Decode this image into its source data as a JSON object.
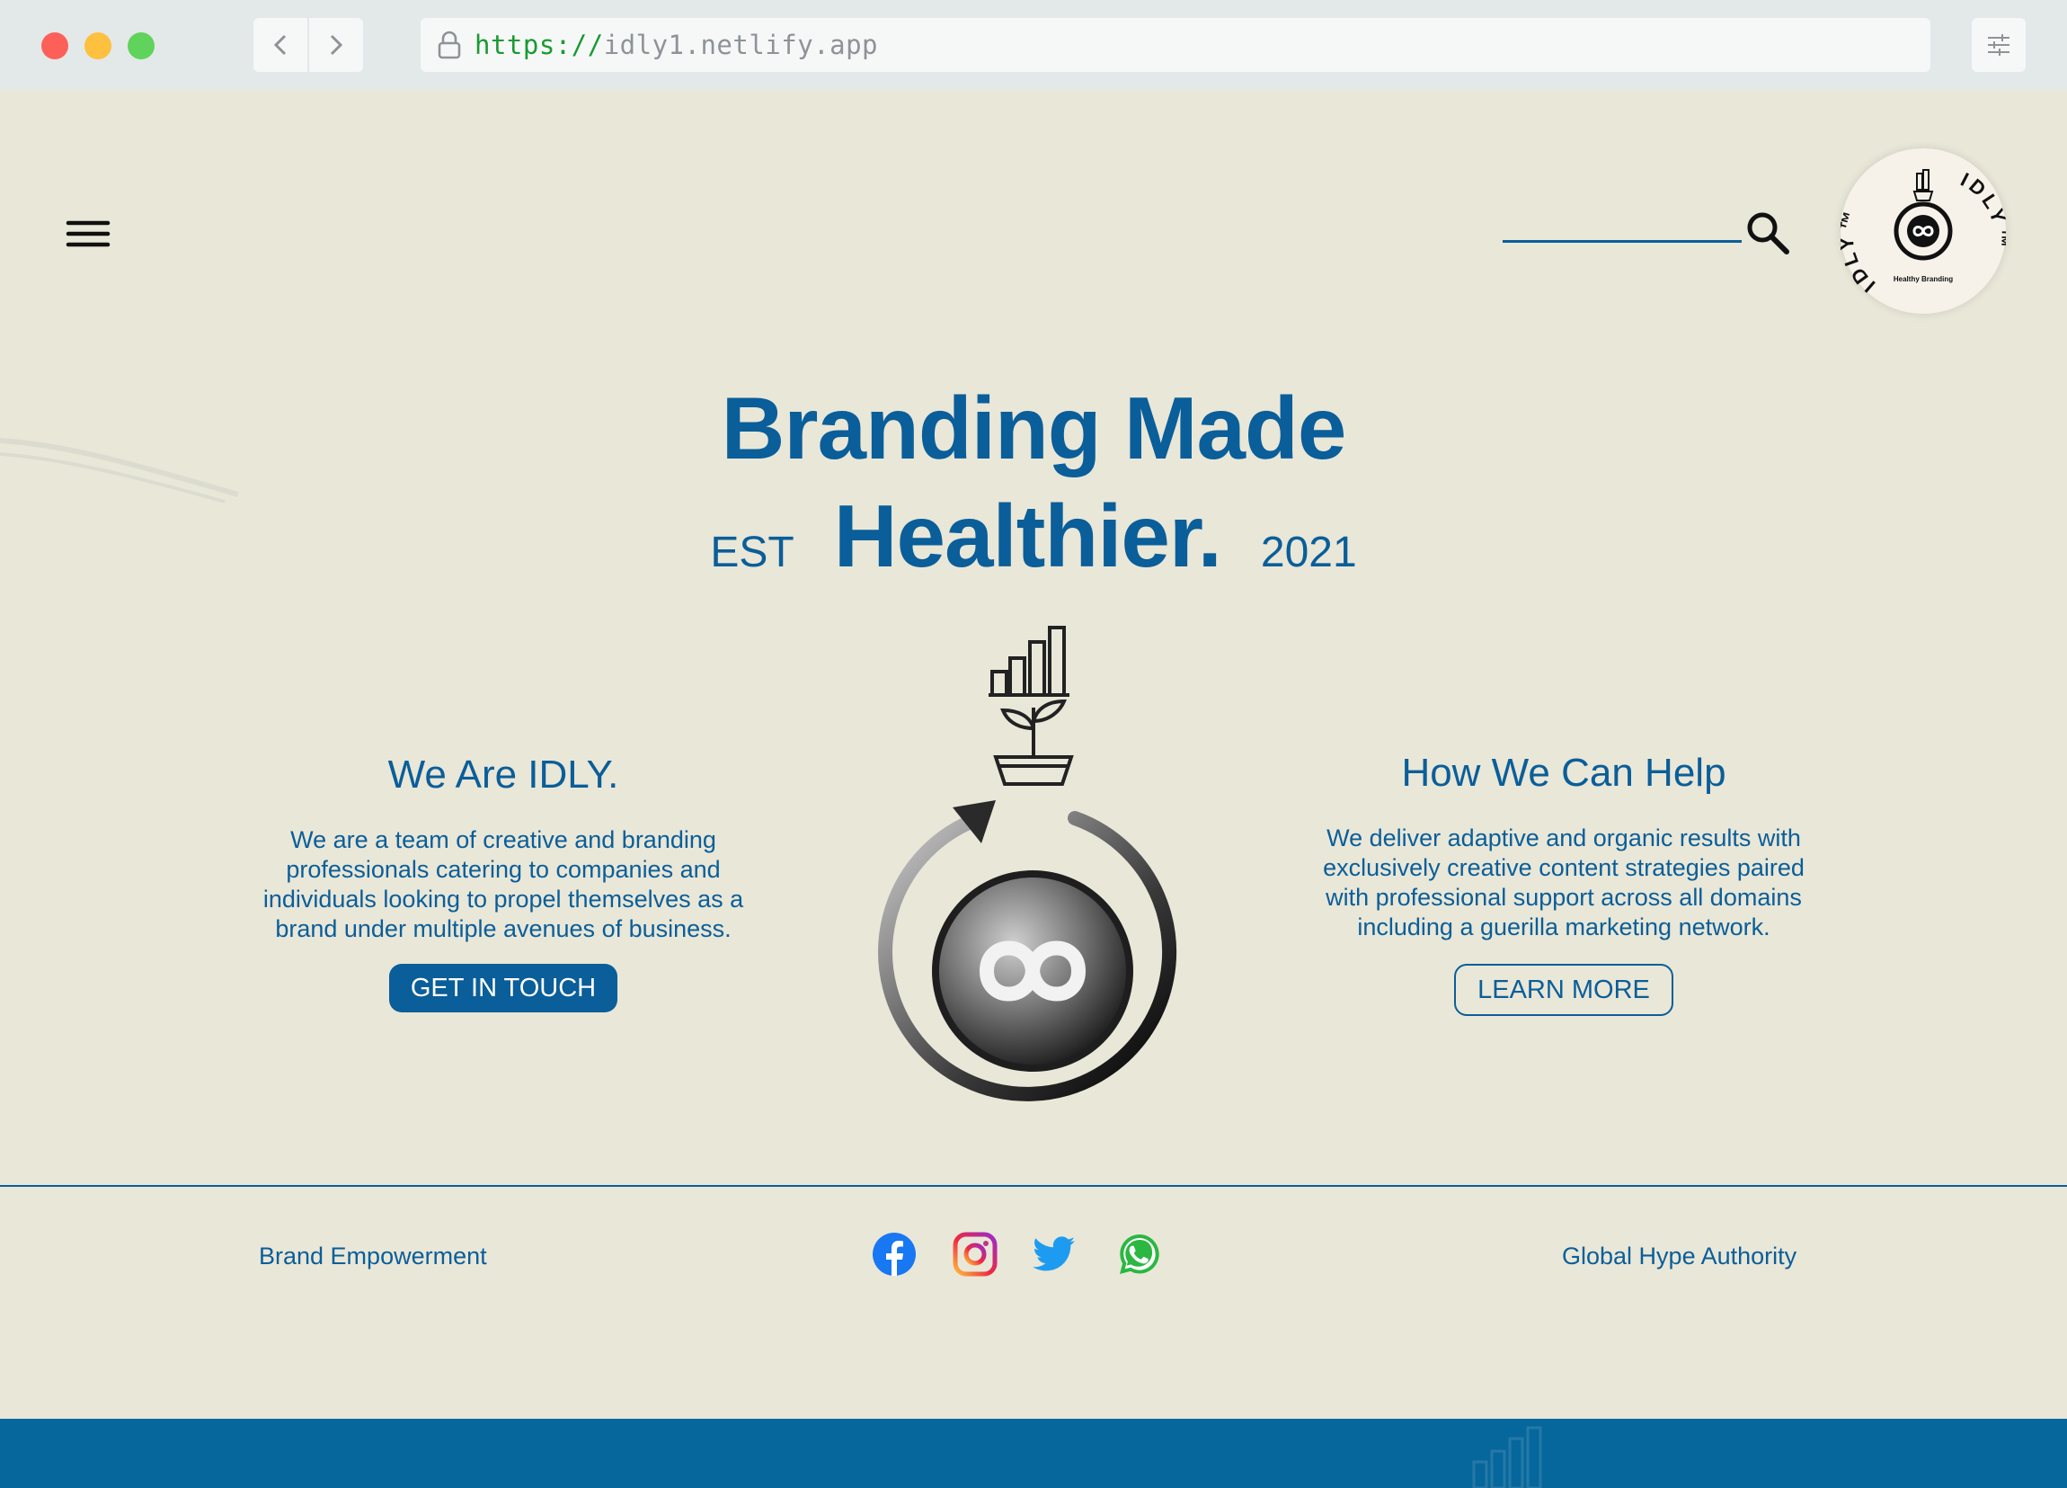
{
  "browser": {
    "url_scheme": "https://",
    "url_host": "idly1.netlify.app",
    "icons": [
      "back-icon",
      "forward-icon",
      "lock-icon",
      "sliders-icon"
    ]
  },
  "header": {
    "menu_icon": "hamburger-menu-icon",
    "search": {
      "value": "",
      "placeholder": ""
    },
    "search_icon": "search-icon",
    "logo": {
      "ring_text": "IDLY™ IDLY™",
      "tagline": "Healthy Branding"
    }
  },
  "hero": {
    "line1": "Branding Made",
    "line2_prefix": "EST",
    "line2_main": "Healthier.",
    "line2_suffix": "2021"
  },
  "about": {
    "heading": "We Are IDLY.",
    "body": "We are a team of creative and branding professionals catering to companies and individuals looking to propel themselves as a brand under multiple avenues of business.",
    "button": "GET IN TOUCH"
  },
  "help": {
    "heading": "How We Can Help",
    "body": "We deliver adaptive and organic results with exclusively creative content strategies paired with professional support across all domains including a guerilla marketing network.",
    "button": "LEARN MORE"
  },
  "footer": {
    "left_text": "Brand Empowerment",
    "right_text": "Global Hype Authority",
    "social": [
      "facebook-icon",
      "instagram-icon",
      "twitter-icon",
      "whatsapp-icon"
    ]
  },
  "colors": {
    "background": "#e9e7d8",
    "brand_blue": "#0a5e99",
    "band_blue": "#05679c"
  }
}
